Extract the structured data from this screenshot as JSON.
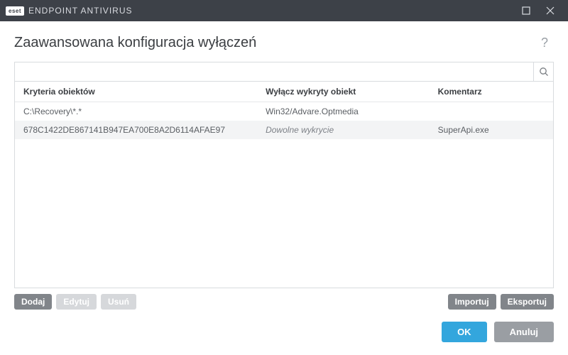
{
  "titlebar": {
    "brand_badge": "eset",
    "brand_text": "ENDPOINT ANTIVIRUS"
  },
  "header": {
    "title": "Zaawansowana konfiguracja wyłączeń"
  },
  "search": {
    "value": "",
    "placeholder": ""
  },
  "table": {
    "columns": {
      "criteria": "Kryteria obiektów",
      "exclude": "Wyłącz wykryty obiekt",
      "comment": "Komentarz"
    },
    "rows": [
      {
        "criteria": "C:\\Recovery\\*.*",
        "exclude": "Win32/Advare.Optmedia",
        "exclude_italic": false,
        "comment": ""
      },
      {
        "criteria": "678C1422DE867141B947EA700E8A2D6114AFAE97",
        "exclude": "Dowolne wykrycie",
        "exclude_italic": true,
        "comment": "SuperApi.exe"
      }
    ]
  },
  "toolbar": {
    "add": "Dodaj",
    "edit": "Edytuj",
    "delete": "Usuń",
    "import": "Importuj",
    "export": "Eksportuj"
  },
  "footer": {
    "ok": "OK",
    "cancel": "Anuluj"
  }
}
